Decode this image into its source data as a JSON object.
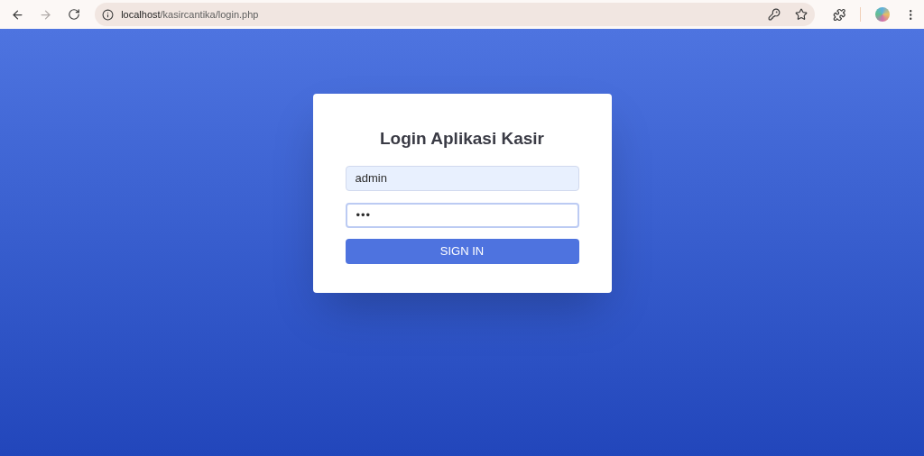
{
  "browser": {
    "url_host": "localhost",
    "url_path": "/kasircantika/login.php",
    "forward_disabled": true
  },
  "login": {
    "title": "Login Aplikasi Kasir",
    "fields": [
      {
        "kind": "text",
        "value": "admin",
        "autofilled": true,
        "focused": false
      },
      {
        "kind": "password",
        "value": "•••",
        "autofilled": false,
        "focused": true
      }
    ],
    "button": "SIGN IN"
  }
}
